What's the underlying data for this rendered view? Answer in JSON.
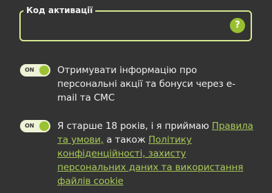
{
  "activation": {
    "legend": "Код активації",
    "value": "",
    "help_glyph": "?"
  },
  "consents": [
    {
      "toggle_label": "ON",
      "checked": true,
      "text": "Отримувати інформацію про персональні акції та бонуси через e-mail та СМС"
    },
    {
      "toggle_label": "ON",
      "checked": true,
      "text_before": "Я старше 18 років, і я приймаю ",
      "link_rules": "Правила та умови,",
      "text_middle": " а також ",
      "link_policy": "Політику конфіденційності, захисту персональних даних та використання файлів cookie"
    }
  ],
  "colors": {
    "background": "#333333",
    "accent": "#d6ea93",
    "knob": "#9bc232",
    "link": "#a9c95a"
  },
  "icons": {
    "help": "question-mark-circle-icon"
  }
}
